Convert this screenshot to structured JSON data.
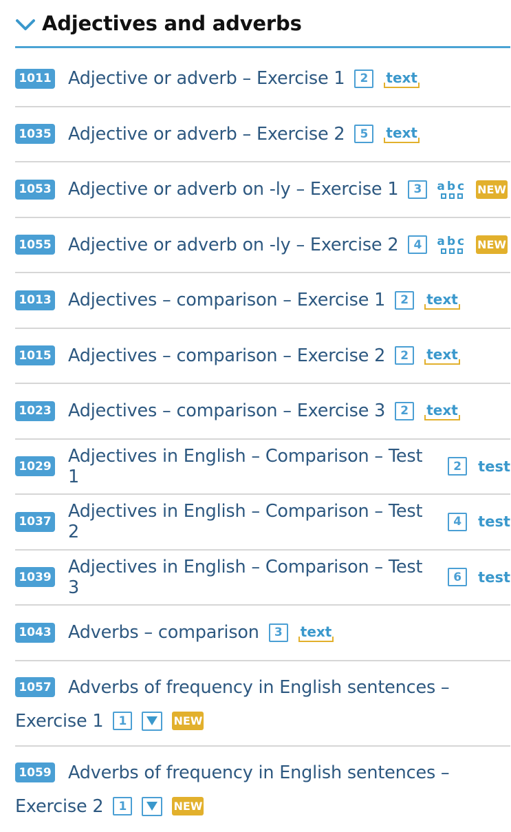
{
  "header": {
    "title": "Adjectives and adverbs"
  },
  "items": [
    {
      "num": "1011",
      "title": "Adjective or adverb – Exercise 1",
      "count": "2",
      "tag": "text"
    },
    {
      "num": "1035",
      "title": "Adjective or adverb – Exercise 2",
      "count": "5",
      "tag": "text"
    },
    {
      "num": "1053",
      "title": "Adjective or adverb on -ly – Exercise 1",
      "count": "3",
      "tag": "abc",
      "abc": "abc",
      "new": "NEW"
    },
    {
      "num": "1055",
      "title": "Adjective or adverb on -ly – Exercise 2",
      "count": "4",
      "tag": "abc",
      "abc": "abc",
      "new": "NEW"
    },
    {
      "num": "1013",
      "title": "Adjectives – comparison – Exercise 1",
      "count": "2",
      "tag": "text"
    },
    {
      "num": "1015",
      "title": "Adjectives – comparison – Exercise 2",
      "count": "2",
      "tag": "text"
    },
    {
      "num": "1023",
      "title": "Adjectives – comparison – Exercise 3",
      "count": "2",
      "tag": "text"
    },
    {
      "num": "1029",
      "title": "Adjectives in English – Comparison – Test 1",
      "count": "2",
      "tag": "test"
    },
    {
      "num": "1037",
      "title": "Adjectives in English – Comparison – Test 2",
      "count": "4",
      "tag": "test"
    },
    {
      "num": "1039",
      "title": "Adjectives in English – Comparison – Test 3",
      "count": "6",
      "tag": "test"
    },
    {
      "num": "1043",
      "title": "Adverbs – comparison",
      "count": "3",
      "tag": "text"
    },
    {
      "num": "1057",
      "title": "Adverbs of frequency in English sentences –",
      "title2": "Exercise 1",
      "count": "1",
      "tag": "dropdown",
      "new": "NEW"
    },
    {
      "num": "1059",
      "title": "Adverbs of frequency in English sentences –",
      "title2": "Exercise 2",
      "count": "1",
      "tag": "dropdown",
      "new": "NEW"
    }
  ],
  "labels": {
    "text": "text",
    "test": "test"
  },
  "colors": {
    "accent": "#4a9fd4",
    "new_badge": "#e2b02c",
    "title_text": "#2d5880",
    "divider": "#d6d6d6"
  },
  "icons": {
    "header": "chevron-down-icon",
    "abc": "letter-boxes-icon",
    "dropdown": "dropdown-triangle-icon"
  }
}
